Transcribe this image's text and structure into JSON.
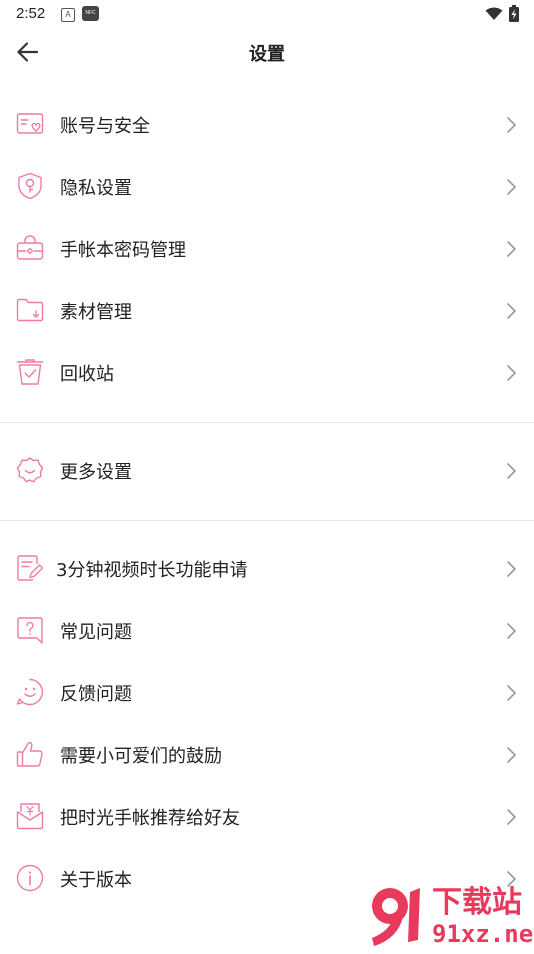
{
  "status": {
    "time": "2:52",
    "a_badge": "A",
    "nfc_badge": "NFC"
  },
  "header": {
    "title": "设置"
  },
  "groups": [
    [
      {
        "label": "账号与安全",
        "icon": "account-card-icon"
      },
      {
        "label": "隐私设置",
        "icon": "privacy-shield-icon"
      },
      {
        "label": "手帐本密码管理",
        "icon": "lock-bag-icon"
      },
      {
        "label": "素材管理",
        "icon": "folder-icon"
      },
      {
        "label": "回收站",
        "icon": "trash-bin-icon"
      }
    ],
    [
      {
        "label": "更多设置",
        "icon": "gear-icon"
      }
    ],
    [
      {
        "label": "3分钟视频时长功能申请",
        "icon": "edit-document-icon"
      },
      {
        "label": "常见问题",
        "icon": "question-bubble-icon"
      },
      {
        "label": "反馈问题",
        "icon": "smile-icon"
      },
      {
        "label": "需要小可爱们的鼓励",
        "icon": "thumbs-up-icon"
      },
      {
        "label": "把时光手帐推荐给好友",
        "icon": "share-gift-icon"
      },
      {
        "label": "关于版本",
        "icon": "info-icon"
      }
    ]
  ],
  "watermark": {
    "big": "下载站",
    "url": "91xz.net"
  },
  "colors": {
    "accent": "#f07aa6",
    "chevron": "#9a9a9a",
    "divider": "#e6e6e6"
  }
}
